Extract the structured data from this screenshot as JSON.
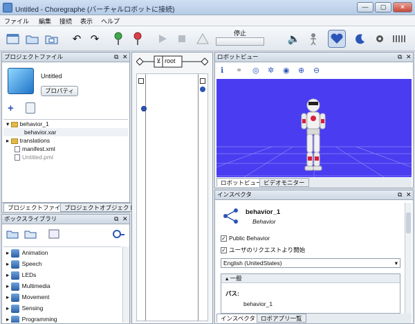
{
  "window": {
    "title": "Untitled - Choregraphe (バーチャルロボットに接続)",
    "min": "—",
    "max": "▢",
    "close": "✕"
  },
  "menu": [
    "ファイル",
    "編集",
    "接続",
    "表示",
    "ヘルプ"
  ],
  "toolbar": {
    "status_label": "停止",
    "selected_icon": "heart-icon"
  },
  "project_panel": {
    "title": "プロジェクトファイル",
    "project_name": "Untitled",
    "properties_button": "プロパティ",
    "files": [
      {
        "name": "behavior_1",
        "type": "folder"
      },
      {
        "name": "behavior.xar",
        "type": "file"
      },
      {
        "name": "translations",
        "type": "folder"
      },
      {
        "name": "manifest.xml",
        "type": "file"
      },
      {
        "name": "Untitled.pml",
        "type": "file"
      }
    ],
    "tabs": [
      "プロジェクトファイル",
      "プロジェクトオブジェクト"
    ]
  },
  "box_library": {
    "title": "ボックスライブラリ",
    "items": [
      "Animation",
      "Speech",
      "LEDs",
      "Multimedia",
      "Movement",
      "Sensing",
      "Programming"
    ]
  },
  "flow": {
    "root_label": "root"
  },
  "robot_view": {
    "title": "ロボットビュー",
    "tabs": [
      "ロボットビュー",
      "ビデオモニター"
    ],
    "bg_color": "#4a3cf0"
  },
  "inspector": {
    "title": "インスペクタ",
    "name": "behavior_1",
    "type": "Behavior",
    "public_behavior": "Public Behavior",
    "start_on_request": "ユーザのリクエストより開始",
    "language": "English (UnitedStates)",
    "section": "一般",
    "path_label": "パス:",
    "path_value": "behavior_1",
    "tabs": [
      "インスペクタ",
      "ロボアプリ一覧"
    ]
  }
}
